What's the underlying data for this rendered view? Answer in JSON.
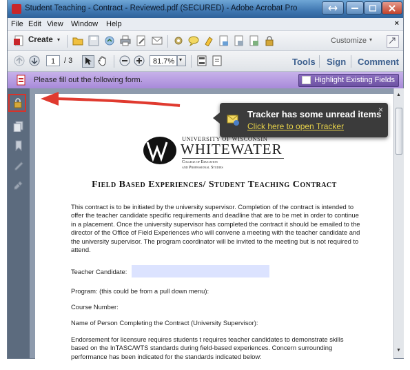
{
  "window": {
    "title": "Student Teaching - Contract - Reviewed.pdf (SECURED) - Adobe Acrobat Pro"
  },
  "menu": [
    "File",
    "Edit",
    "View",
    "Window",
    "Help"
  ],
  "toolbar": {
    "create_label": "Create",
    "customize_label": "Customize"
  },
  "nav": {
    "current_page": "1",
    "total_pages": "/ 3",
    "zoom": "81.7%"
  },
  "panels": {
    "tools": "Tools",
    "sign": "Sign",
    "comment": "Comment"
  },
  "formbar": {
    "message": "Please fill out the following form.",
    "highlight_label": "Highlight Existing Fields"
  },
  "tracker": {
    "title": "Tracker has some unread items",
    "link": "Click here to open Tracker",
    "close": "×"
  },
  "document": {
    "logo": {
      "university_of": "UNIVERSITY OF WISCONSIN",
      "whitewater": "WHITEWATER",
      "college": "College of Education",
      "professional": "and Professional Studies"
    },
    "heading": "Field Based Experiences/ Student Teaching Contract",
    "intro": "This contract is to be initiated by the university supervisor.  Completion of the contract is intended to offer the teacher candidate specific requirements and deadline that are to be met in order to continue in a placement.  Once the university supervisor has completed the contract it should be emailed to the director of the Office of Field Experiences who will convene a meeting with the teacher candidate and the university supervisor.  The program coordinator will be invited to the meeting but is not required to attend.",
    "teacher_candidate_label": "Teacher Candidate:",
    "program_label": "Program:  (this could be from a pull down menu):",
    "course_label": "Course Number:",
    "person_label": "Name of Person Completing the Contract (University Supervisor):",
    "endorsement": "Endorsement for licensure requires students t requires teacher candidates to demonstrate skills based on the InTASC/WTS standards during field-based experiences.  Concern surrounding performance has been indicated for the standards indicated below:"
  },
  "colors": {
    "formbar": "#b59ce0",
    "annotation_arrow": "#e03a2f",
    "tracker_link": "#e7d24a"
  }
}
